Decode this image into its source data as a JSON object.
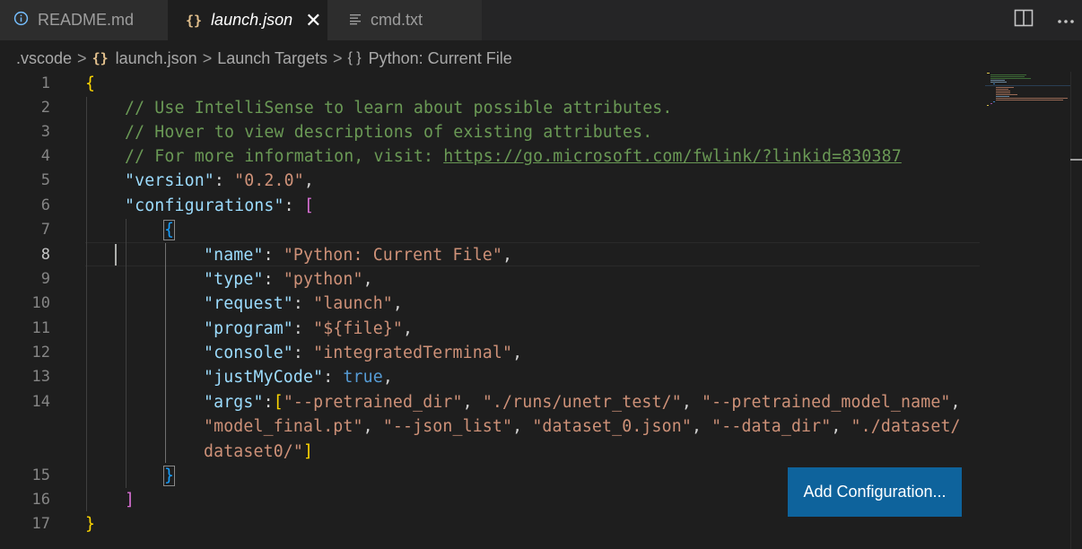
{
  "tabs": [
    {
      "icon": "info-icon",
      "label": "README.md",
      "active": false
    },
    {
      "icon": "json-braces-icon",
      "icon_glyph": "{}",
      "label": "launch.json",
      "active": true,
      "close_glyph": "✕"
    },
    {
      "icon": "text-lines-icon",
      "label": "cmd.txt",
      "active": false
    }
  ],
  "tab_actions": [
    "split-editor-icon",
    "more-actions-icon"
  ],
  "breadcrumb": {
    "items": [
      ".vscode",
      "launch.json",
      "Launch Targets",
      "Python: Current File"
    ],
    "separator": ">",
    "json_glyph": "{}",
    "object_glyph": "{ }"
  },
  "line_numbers": [
    "1",
    "2",
    "3",
    "4",
    "5",
    "6",
    "7",
    "8",
    "9",
    "10",
    "11",
    "12",
    "13",
    "14",
    "15",
    "16",
    "17"
  ],
  "current_line": "8",
  "code": {
    "l1": {
      "b0": "{"
    },
    "l2": {
      "c": "// Use IntelliSense to learn about possible attributes."
    },
    "l3": {
      "c": "// Hover to view descriptions of existing attributes."
    },
    "l4": {
      "c": "// For more information, visit: ",
      "url": "https://go.microsoft.com/fwlink/?linkid=830387"
    },
    "l5": {
      "k": "\"version\"",
      "p": ": ",
      "s": "\"0.2.0\"",
      "e": ","
    },
    "l6": {
      "k": "\"configurations\"",
      "p": ": ",
      "b": "["
    },
    "l7": {
      "b": "{"
    },
    "l8": {
      "k": "\"name\"",
      "p": ": ",
      "s": "\"Python: Current File\"",
      "e": ","
    },
    "l9": {
      "k": "\"type\"",
      "p": ": ",
      "s": "\"python\"",
      "e": ","
    },
    "l10": {
      "k": "\"request\"",
      "p": ": ",
      "s": "\"launch\"",
      "e": ","
    },
    "l11": {
      "k": "\"program\"",
      "p": ": ",
      "s": "\"${file}\"",
      "e": ","
    },
    "l12": {
      "k": "\"console\"",
      "p": ": ",
      "s": "\"integratedTerminal\"",
      "e": ","
    },
    "l13": {
      "k": "\"justMyCode\"",
      "p": ": ",
      "v": "true",
      "e": ","
    },
    "l14a": {
      "k": "\"args\"",
      "p": ":",
      "b": "[",
      "s1": "\"--pretrained_dir\"",
      "c1": ", ",
      "s2": "\"./runs/unetr_test/\"",
      "c2": ", ",
      "s3": "\"--pretrained_model_name\"",
      "e": ","
    },
    "l14b": {
      "s1": "\"model_final.pt\"",
      "c1": ", ",
      "s2": "\"--json_list\"",
      "c2": ", ",
      "s3": "\"dataset_0.json\"",
      "c3": ", ",
      "s4": "\"--data_dir\"",
      "c4": ", ",
      "s5": "\"./dataset/"
    },
    "l14c": {
      "s": "dataset0/\"",
      "b": "]"
    },
    "l15": {
      "b": "}"
    },
    "l16": {
      "b": "]"
    },
    "l17": {
      "b0": "}"
    }
  },
  "add_configuration_button": "Add Configuration...",
  "colors": {
    "editor_bg": "#1e1e1e",
    "key": "#9cdcfe",
    "string": "#ce9178",
    "comment": "#6a9955",
    "boolean": "#569cd6",
    "bracket_level1": "#ffd700",
    "bracket_level2": "#da70d6",
    "bracket_level3": "#179fff",
    "button_bg": "#0e639c"
  }
}
